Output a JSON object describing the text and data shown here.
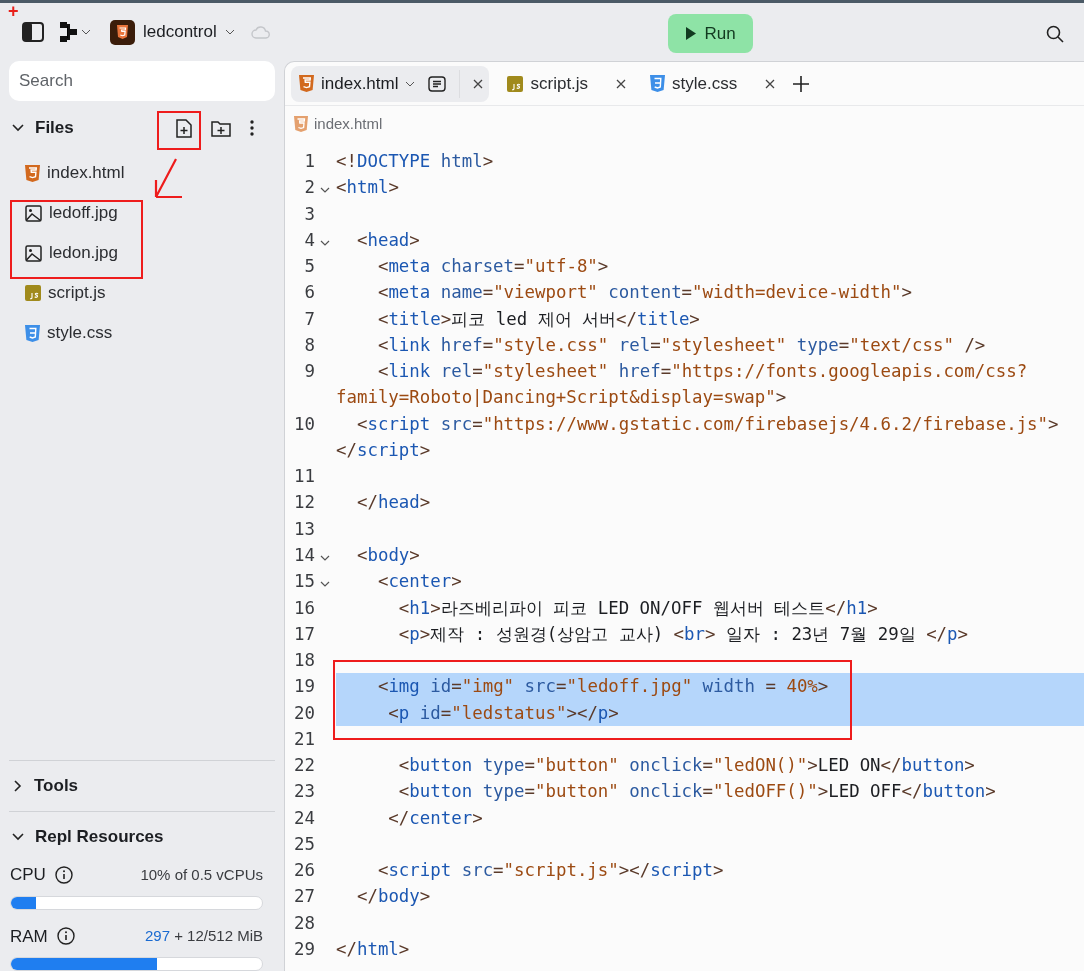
{
  "annotations": {
    "plus_mark": "+"
  },
  "topbar": {
    "project": "ledcontrol",
    "run_label": "Run"
  },
  "sidebar": {
    "search": {
      "placeholder": "Search"
    },
    "files_header": "Files",
    "files_expanded": true,
    "files": [
      {
        "name": "index.html",
        "kind": "html"
      },
      {
        "name": "ledoff.jpg",
        "kind": "image"
      },
      {
        "name": "ledon.jpg",
        "kind": "image"
      },
      {
        "name": "script.js",
        "kind": "js"
      },
      {
        "name": "style.css",
        "kind": "css"
      }
    ],
    "sections": [
      {
        "title": "Tools",
        "expanded": false
      },
      {
        "title": "Repl Resources",
        "expanded": true
      }
    ],
    "resources": [
      {
        "label": "CPU",
        "reading": "10% of 0.5 vCPUs",
        "level": 0.1
      },
      {
        "label": "RAM",
        "reading_used": "297",
        "reading": "+ 12/512 MiB",
        "level": 0.58
      }
    ]
  },
  "tabs": [
    {
      "label": "index.html",
      "kind": "html",
      "selected": true
    },
    {
      "label": "script.js",
      "kind": "js",
      "selected": false
    },
    {
      "label": "style.css",
      "kind": "css",
      "selected": false
    }
  ],
  "breadcrumb": "index.html",
  "code": [
    {
      "n": "1",
      "text": "<!DOCTYPE html>",
      "fold": false,
      "highlighted": false
    },
    {
      "n": "2",
      "text": "<html>",
      "fold": true,
      "highlighted": false
    },
    {
      "n": "3",
      "fold": false,
      "highlighted": false
    },
    {
      "n": "4",
      "text": "  <head>",
      "fold": true,
      "highlighted": false
    },
    {
      "n": "5",
      "text": "    <meta charset=\"utf-8\">",
      "fold": false,
      "highlighted": false
    },
    {
      "n": "6",
      "text": "    <meta name=\"viewport\" content=\"width=device-width\">",
      "fold": false,
      "highlighted": false
    },
    {
      "n": "7",
      "text": "    <title>피코 led 제어 서버</title>",
      "fold": false,
      "highlighted": false
    },
    {
      "n": "8",
      "text": "    <link href=\"style.css\" rel=\"stylesheet\" type=\"text/css\" />",
      "fold": false,
      "highlighted": false
    },
    {
      "n": "9",
      "text": "    <link rel=\"stylesheet\" href=\"https://fonts.googleapis.com/css?",
      "wrapped": "family=Roboto|Dancing+Script&display=swap\">",
      "fold": false,
      "highlighted": false
    },
    {
      "n": "10",
      "text": "  <script src=\"https://www.gstatic.com/firebasejs/4.6.2/firebase.js\">",
      "wrapped": "</script>",
      "fold": false,
      "highlighted": false
    },
    {
      "n": "11",
      "fold": false,
      "highlighted": false
    },
    {
      "n": "12",
      "text": "  </head>",
      "fold": false,
      "highlighted": false
    },
    {
      "n": "13",
      "fold": false,
      "highlighted": false
    },
    {
      "n": "14",
      "text": "  <body>",
      "fold": true,
      "highlighted": false
    },
    {
      "n": "15",
      "text": "    <center>",
      "fold": true,
      "highlighted": false
    },
    {
      "n": "16",
      "text": "      <h1>라즈베리파이 피코 LED ON/OFF 웹서버 테스트</h1>",
      "fold": false,
      "highlighted": false
    },
    {
      "n": "17",
      "text": "      <p>제작 : 성원경(상암고 교사) <br> 일자 : 23년 7월 29일 </p>",
      "fold": false,
      "highlighted": false
    },
    {
      "n": "18",
      "fold": false,
      "highlighted": false
    },
    {
      "n": "19",
      "text": "    <img id=\"img\" src=\"ledoff.jpg\" width = 40%>",
      "fold": false,
      "highlighted": true
    },
    {
      "n": "20",
      "text": "     <p id=\"ledstatus\"></p>",
      "fold": false,
      "highlighted": true
    },
    {
      "n": "21",
      "fold": false,
      "highlighted": false
    },
    {
      "n": "22",
      "text": "      <button type=\"button\" onclick=\"ledON()\">LED ON</button>",
      "fold": false,
      "highlighted": false
    },
    {
      "n": "23",
      "text": "      <button type=\"button\" onclick=\"ledOFF()\">LED OFF</button>",
      "fold": false,
      "highlighted": false
    },
    {
      "n": "24",
      "text": "     </center>",
      "fold": false,
      "highlighted": false
    },
    {
      "n": "25",
      "fold": false,
      "highlighted": false
    },
    {
      "n": "26",
      "text": "    <script src=\"script.js\"></script>",
      "fold": false,
      "highlighted": false
    },
    {
      "n": "27",
      "text": "  </body>",
      "fold": false,
      "highlighted": false
    },
    {
      "n": "28",
      "fold": false,
      "highlighted": false
    },
    {
      "n": "29",
      "text": "</html>",
      "fold": false,
      "highlighted": false
    }
  ]
}
